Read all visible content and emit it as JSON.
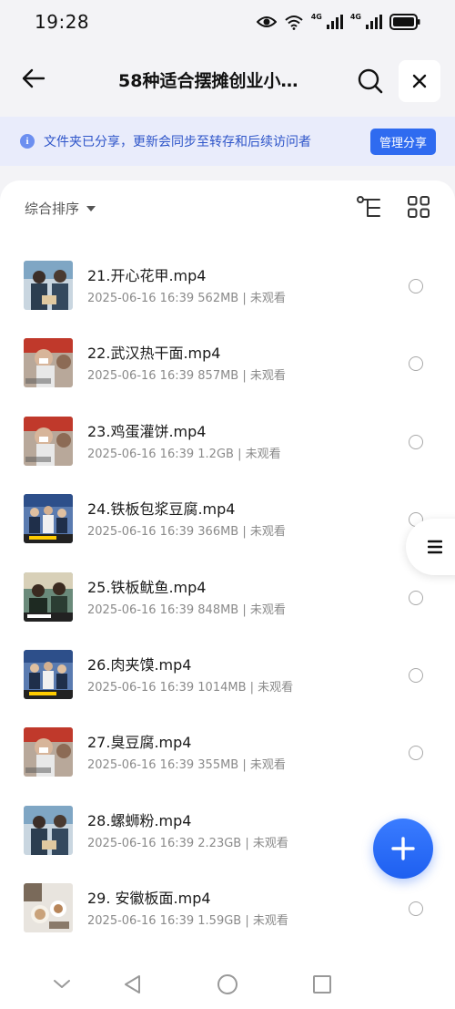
{
  "status_bar": {
    "time": "19:28",
    "network_1": "4G",
    "network_2": "4G",
    "icons": [
      "eye-icon",
      "wifi-icon",
      "signal-icon",
      "signal-icon",
      "battery-icon"
    ]
  },
  "header": {
    "title": "58种适合摆摊创业小…",
    "back_icon": "arrow-left-icon",
    "search_icon": "search-icon",
    "close_icon": "close-icon"
  },
  "notice": {
    "text": "文件夹已分享，更新会同步至转存和后续访问者",
    "button": "管理分享",
    "accent": "#2f6bf0"
  },
  "toolbar": {
    "sort_label": "综合排序",
    "tree_icon": "tree-view-icon",
    "grid_icon": "grid-view-icon"
  },
  "files": [
    {
      "name": "21.开心花甲.mp4",
      "meta": "2025-06-16 16:39  562MB | 未观看",
      "thumb": "a"
    },
    {
      "name": "22.武汉热干面.mp4",
      "meta": "2025-06-16 16:39  857MB | 未观看",
      "thumb": "b"
    },
    {
      "name": "23.鸡蛋灌饼.mp4",
      "meta": "2025-06-16 16:39  1.2GB | 未观看",
      "thumb": "b"
    },
    {
      "name": "24.铁板包浆豆腐.mp4",
      "meta": "2025-06-16 16:39  366MB | 未观看",
      "thumb": "c"
    },
    {
      "name": "25.铁板鱿鱼.mp4",
      "meta": "2025-06-16 16:39  848MB | 未观看",
      "thumb": "d"
    },
    {
      "name": "26.肉夹馍.mp4",
      "meta": "2025-06-16 16:39  1014MB | 未观看",
      "thumb": "c"
    },
    {
      "name": "27.臭豆腐.mp4",
      "meta": "2025-06-16 16:39  355MB | 未观看",
      "thumb": "b"
    },
    {
      "name": "28.螺蛳粉.mp4",
      "meta": "2025-06-16 16:39  2.23GB | 未观看",
      "thumb": "a"
    },
    {
      "name": "29. 安徽板面.mp4",
      "meta": "2025-06-16 16:39  1.59GB | 未观看",
      "thumb": "e"
    }
  ],
  "floating": {
    "side_handle_icon": "menu-icon",
    "fab_icon": "plus-icon"
  },
  "navbar": {
    "icons": [
      "chevron-down-icon",
      "back-triangle-icon",
      "home-circle-icon",
      "recents-square-icon"
    ]
  }
}
